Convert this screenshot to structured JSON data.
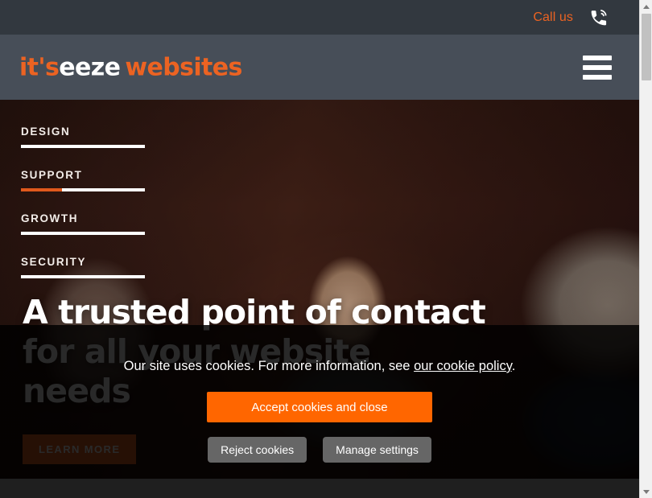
{
  "topbar": {
    "call_label": "Call us",
    "phone_icon": "phone-ringing-icon",
    "accent_color": "#ec6322",
    "background_color": "#32383f"
  },
  "header": {
    "logo": {
      "part_orange_1": "it's",
      "part_white": "eeze",
      "part_orange_2": "websites",
      "orange_color": "#ec6322",
      "white_color": "#ffffff"
    },
    "menu_icon": "hamburger-menu-icon",
    "background_color": "#474e58"
  },
  "hero": {
    "features": [
      {
        "label": "DESIGN",
        "progress": 0
      },
      {
        "label": "SUPPORT",
        "progress": 33
      },
      {
        "label": "GROWTH",
        "progress": 0
      },
      {
        "label": "SECURITY",
        "progress": 0
      }
    ],
    "heading_line_1": "A trusted point of contact",
    "heading_line_2": "for all your website",
    "heading_line_3": "needs",
    "cta_label": "LEARN MORE",
    "cta_color": "#ec6322",
    "progress_fill_color": "#e0591c"
  },
  "cookie_banner": {
    "message_prefix": "Our site uses cookies. For more information, see ",
    "policy_link": "our cookie policy",
    "message_suffix": ".",
    "accept_label": "Accept cookies and close",
    "reject_label": "Reject cookies",
    "manage_label": "Manage settings",
    "accept_color": "#ff6600",
    "secondary_color": "#666666",
    "overlay_color": "rgba(0,0,0,0.84)"
  },
  "scrollbar": {
    "up_arrow_icon": "chevron-up-icon",
    "down_arrow_icon": "chevron-down-icon",
    "thumb_icon": "scrollbar-thumb"
  }
}
